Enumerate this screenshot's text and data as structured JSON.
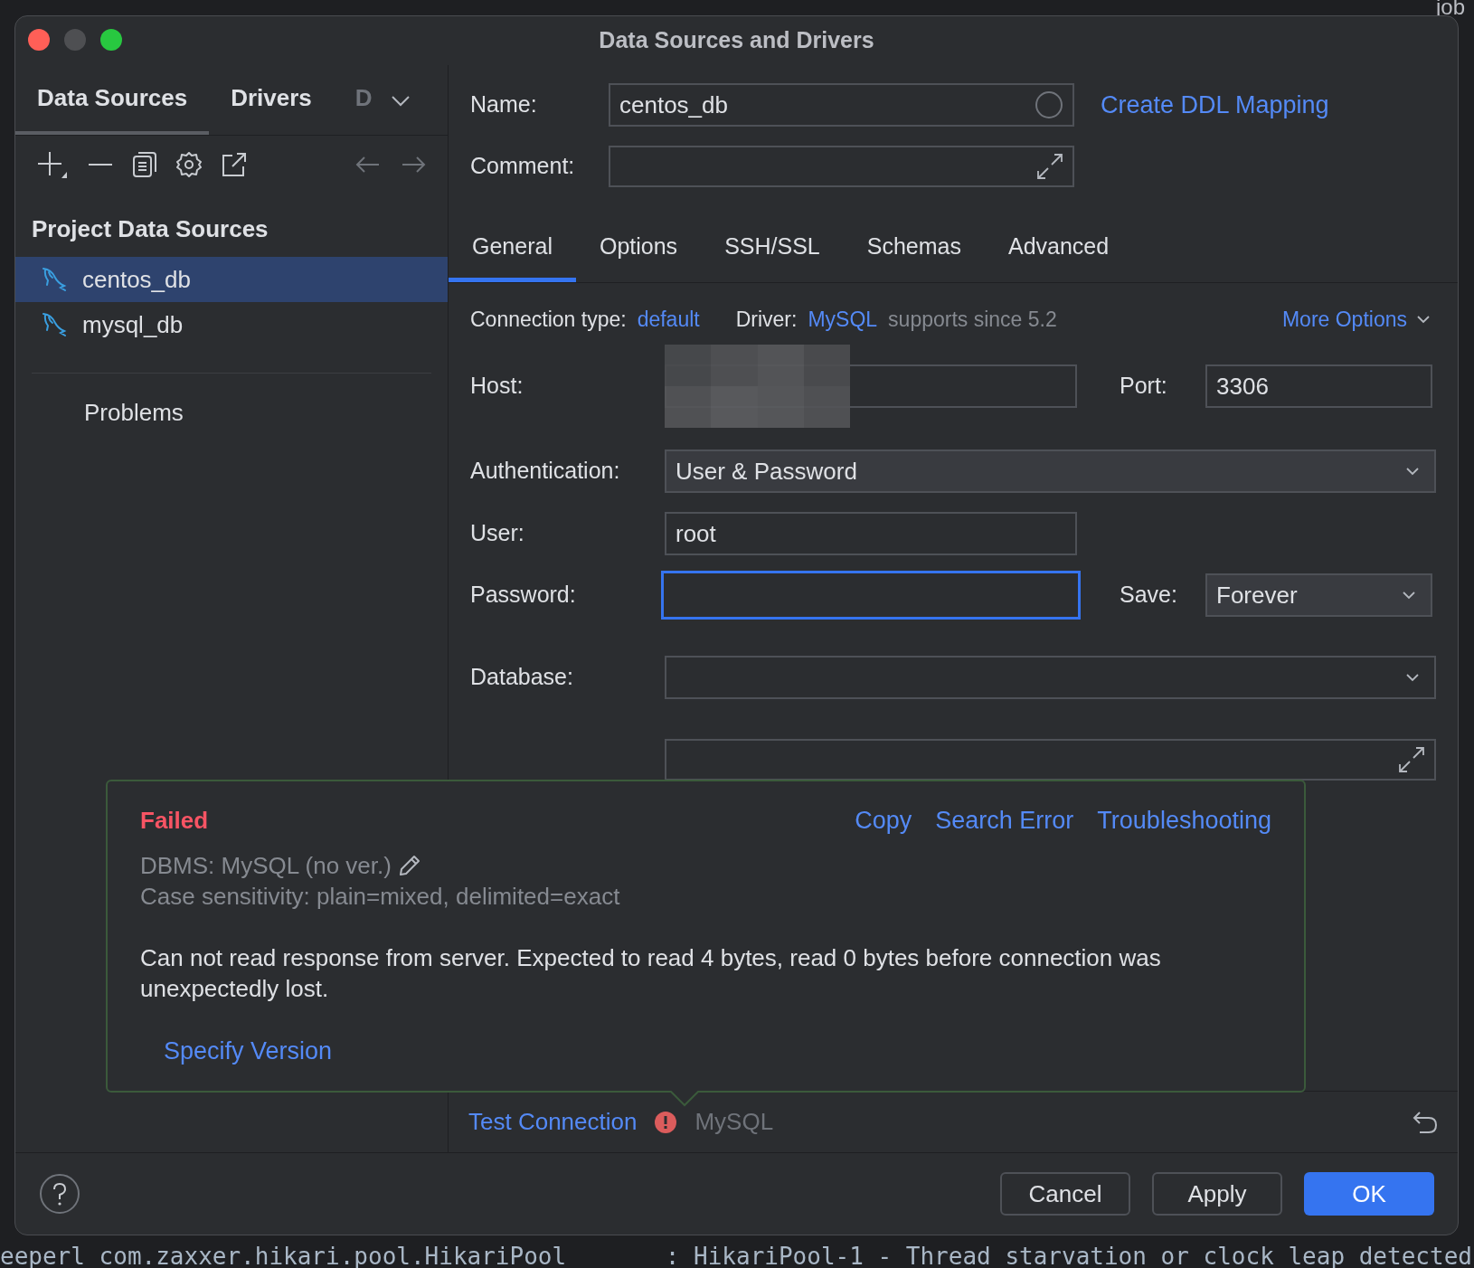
{
  "background": {
    "corner_text": "job",
    "log_line": "eeperl com.zaxxer.hikari.pool.HikariPool       : HikariPool-1 - Thread starvation or clock leap detected"
  },
  "window": {
    "title": "Data Sources and Drivers"
  },
  "left_tabs": [
    {
      "label": "Data Sources",
      "selected": true
    },
    {
      "label": "Drivers",
      "selected": false
    },
    {
      "label": "D",
      "selected": false
    }
  ],
  "sidebar": {
    "heading": "Project Data Sources",
    "items": [
      {
        "label": "centos_db",
        "selected": true
      },
      {
        "label": "mysql_db",
        "selected": false
      }
    ],
    "problems": "Problems"
  },
  "header": {
    "name_label": "Name:",
    "name_value": "centos_db",
    "comment_label": "Comment:",
    "ddl_link": "Create DDL Mapping"
  },
  "tabs": [
    {
      "label": "General",
      "selected": true
    },
    {
      "label": "Options",
      "selected": false
    },
    {
      "label": "SSH/SSL",
      "selected": false
    },
    {
      "label": "Schemas",
      "selected": false
    },
    {
      "label": "Advanced",
      "selected": false
    }
  ],
  "connection": {
    "type_label": "Connection type:",
    "type_value": "default",
    "driver_label": "Driver:",
    "driver_value": "MySQL",
    "driver_note": "supports since 5.2",
    "more_options": "More Options"
  },
  "fields": {
    "host": {
      "label": "Host:"
    },
    "port": {
      "label": "Port:",
      "value": "3306"
    },
    "authentication": {
      "label": "Authentication:",
      "value": "User & Password"
    },
    "user": {
      "label": "User:",
      "value": "root"
    },
    "password": {
      "label": "Password:",
      "focused": true
    },
    "save": {
      "label": "Save:",
      "value": "Forever"
    },
    "database": {
      "label": "Database:"
    }
  },
  "popup": {
    "status": "Failed",
    "actions": [
      "Copy",
      "Search Error",
      "Troubleshooting"
    ],
    "dbms": "DBMS: MySQL (no ver.)",
    "case_sensitivity": "Case sensitivity: plain=mixed, delimited=exact",
    "message": "Can not read response from server. Expected to read 4 bytes, read 0 bytes before connection was unexpectedly lost.",
    "link": "Specify Version"
  },
  "test": {
    "label": "Test Connection",
    "error": true,
    "result": "MySQL"
  },
  "buttons": [
    {
      "label": "Cancel",
      "primary": false
    },
    {
      "label": "Apply",
      "primary": false
    },
    {
      "label": "OK",
      "primary": true
    }
  ]
}
